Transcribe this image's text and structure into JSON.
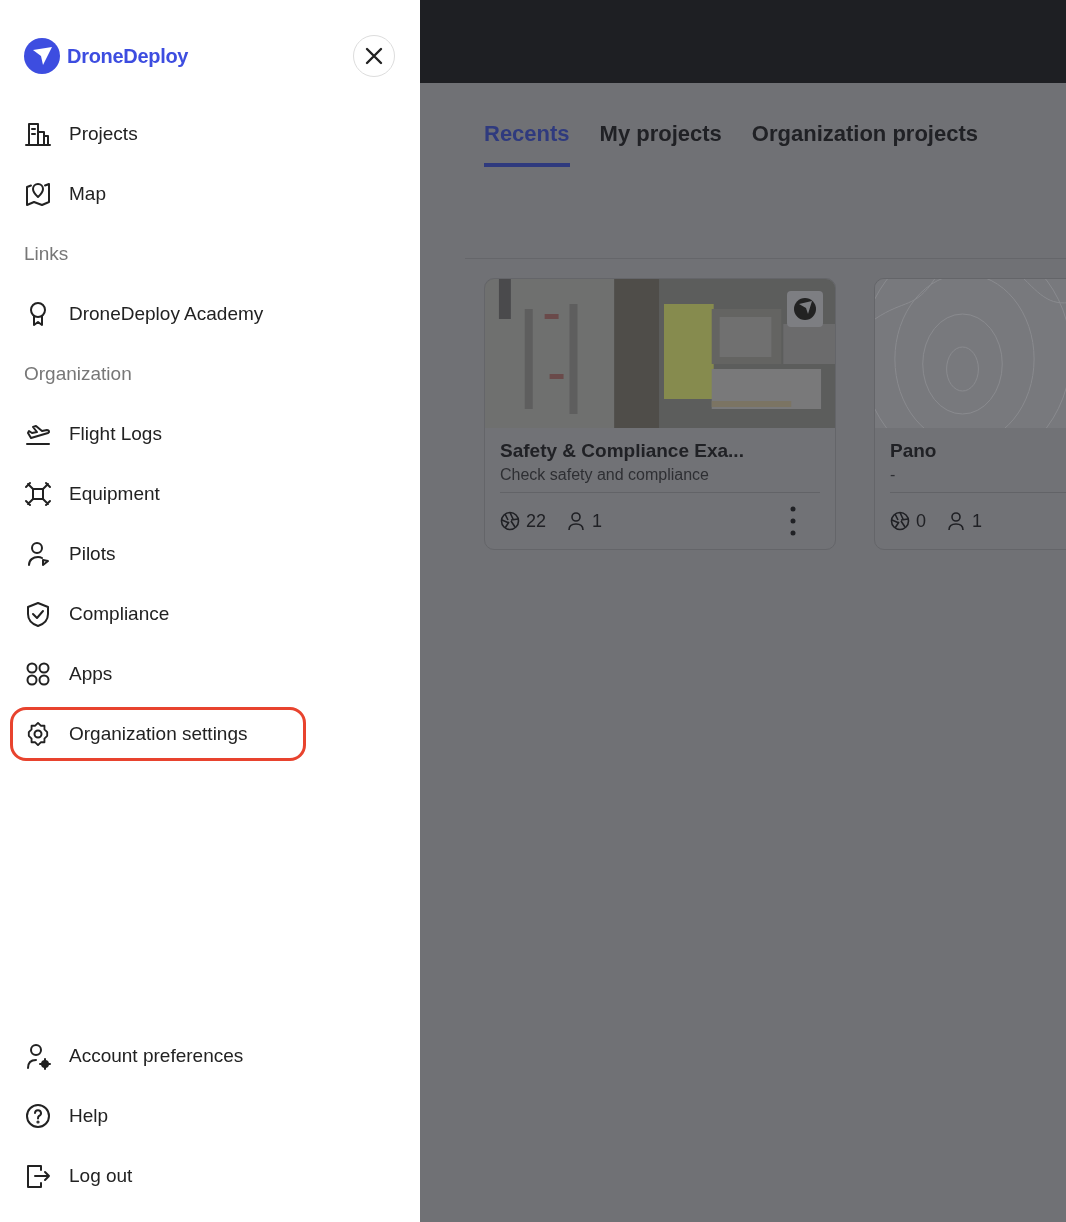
{
  "sidebar": {
    "logo_text": "DroneDeploy",
    "sections": [
      {
        "items": [
          {
            "label": "Projects",
            "highlighted": false
          },
          {
            "label": "Map",
            "highlighted": false
          }
        ]
      },
      {
        "heading": "Links",
        "items": [
          {
            "label": "DroneDeploy Academy",
            "highlighted": false
          }
        ]
      },
      {
        "heading": "Organization",
        "items": [
          {
            "label": "Flight Logs",
            "highlighted": false
          },
          {
            "label": "Equipment",
            "highlighted": false
          },
          {
            "label": "Pilots",
            "highlighted": false
          },
          {
            "label": "Compliance",
            "highlighted": false
          },
          {
            "label": "Apps",
            "highlighted": false
          },
          {
            "label": "Organization settings",
            "highlighted": true
          }
        ]
      }
    ],
    "bottom_items": [
      {
        "label": "Account preferences",
        "highlighted": false
      },
      {
        "label": "Help",
        "highlighted": false
      },
      {
        "label": "Log out",
        "highlighted": false
      }
    ]
  },
  "tabs": [
    {
      "label": "Recents",
      "selected": true
    },
    {
      "label": "My projects",
      "selected": false
    },
    {
      "label": "Organization projects",
      "selected": false
    }
  ],
  "cards": [
    {
      "kind": "picture",
      "title": "Safety & Compliance Exa...",
      "subtitle": "Check safety and compliance",
      "photos": "22",
      "members": "1"
    },
    {
      "kind": "topography",
      "title": "Pano",
      "subtitle": "-",
      "photos": "0",
      "members": "1"
    }
  ]
}
